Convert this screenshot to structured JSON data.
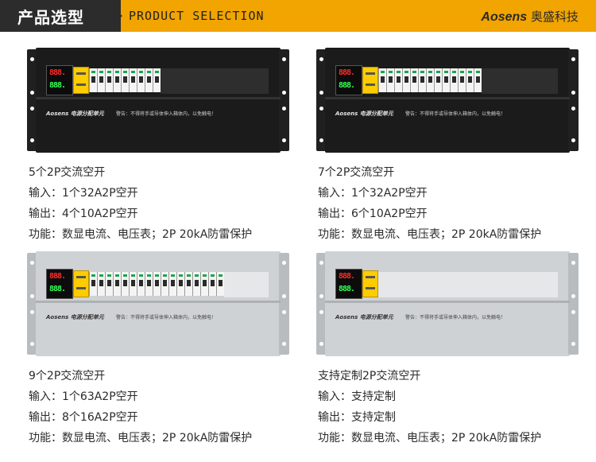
{
  "header": {
    "title_cn": "产品选型",
    "title_en": "PRODUCT SELECTION",
    "brand_en": "Aosens",
    "brand_cn": "奥盛科技"
  },
  "colors": {
    "accent": "#f2a400",
    "header_dark": "#2c2c2c"
  },
  "panel_label": "Aosens 电源分配单元",
  "warning_text": "警告：不得将手或导体伸入箱体内，以免触电！",
  "products": [
    {
      "title": "5个2P交流空开",
      "input": "输入：1个32A2P空开",
      "output": "输出：4个10A2P空开",
      "function": "功能：数显电流、电压表；2P 20kA防雷保护",
      "finish": "black"
    },
    {
      "title": "7个2P交流空开",
      "input": "输入：1个32A2P空开",
      "output": "输出：6个10A2P空开",
      "function": "功能：数显电流、电压表；2P 20kA防雷保护",
      "finish": "black"
    },
    {
      "title": "9个2P交流空开",
      "input": "输入：1个63A2P空开",
      "output": "输出：8个16A2P空开",
      "function": "功能：数显电流、电压表；2P 20kA防雷保护",
      "finish": "silver"
    },
    {
      "title": "支持定制2P交流空开",
      "input": "输入：支持定制",
      "output": "输出：支持定制",
      "function": "功能：数显电流、电压表；2P 20kA防雷保护",
      "finish": "silver"
    }
  ]
}
